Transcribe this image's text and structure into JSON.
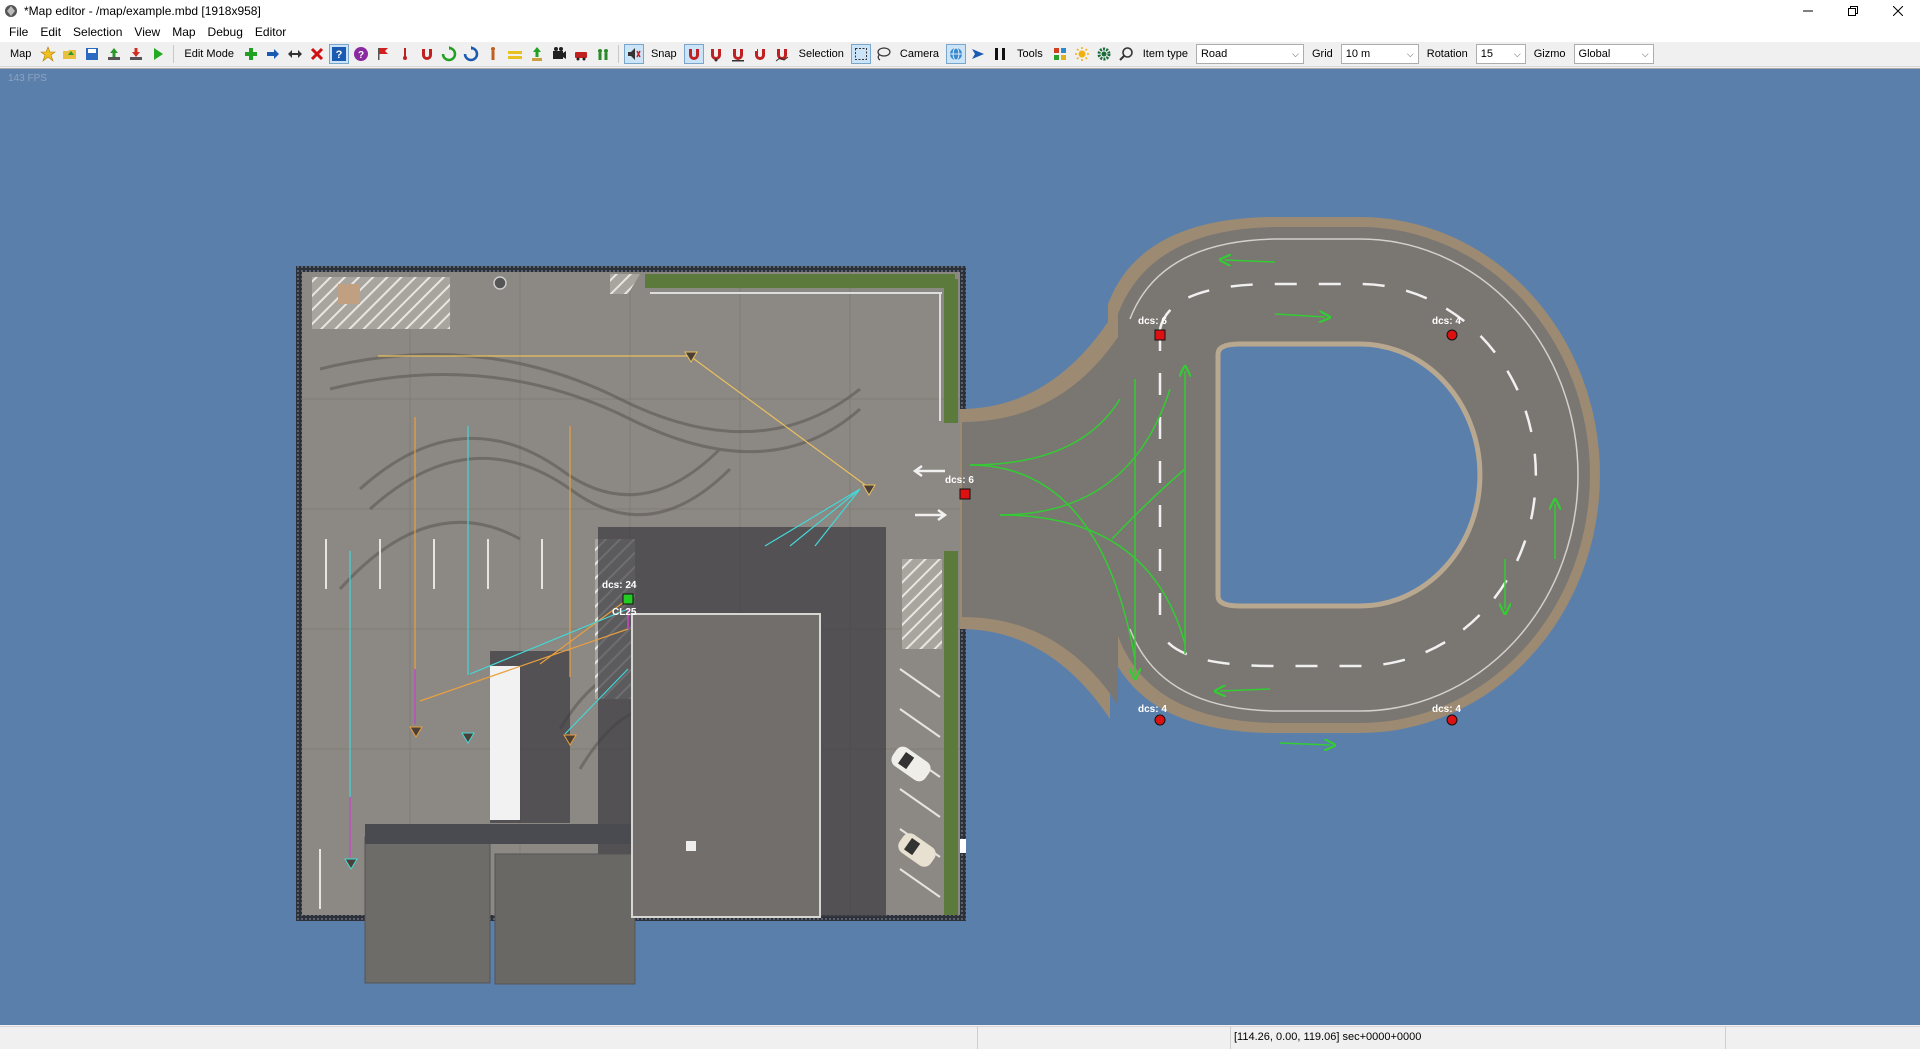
{
  "window": {
    "title": "*Map editor - /map/example.mbd [1918x958]"
  },
  "menubar": {
    "items": [
      "File",
      "Edit",
      "Selection",
      "View",
      "Map",
      "Debug",
      "Editor"
    ]
  },
  "toolbar": {
    "map_label": "Map",
    "edit_mode_label": "Edit Mode",
    "snap_label": "Snap",
    "selection_label": "Selection",
    "camera_label": "Camera",
    "tools_label": "Tools",
    "item_type_label": "Item type",
    "item_type_value": "Road",
    "grid_label": "Grid",
    "grid_value": "10 m",
    "rotation_label": "Rotation",
    "rotation_value": "15",
    "gizmo_label": "Gizmo",
    "gizmo_value": "Global"
  },
  "viewport": {
    "fps_text": "143 FPS",
    "node_labels": {
      "entry_node": "dcs: 6",
      "loop_top_left": "dcs: 6",
      "loop_top_right": "dcs: 4",
      "loop_bottom_left": "dcs: 4",
      "loop_bottom_right": "dcs: 4",
      "building_node": "dcs: 24",
      "building_sub": "CL25"
    },
    "colors": {
      "background": "#5b7fab",
      "asphalt": "#7a7672",
      "lane_arrow": "#33cc33",
      "node_red": "#dd1111",
      "node_green": "#22cc22",
      "path_yellow": "#e8c060",
      "path_cyan": "#44d8d8"
    }
  },
  "statusbar": {
    "coords": "[114.26, 0.00, 119.06] sec+0000+0000"
  }
}
